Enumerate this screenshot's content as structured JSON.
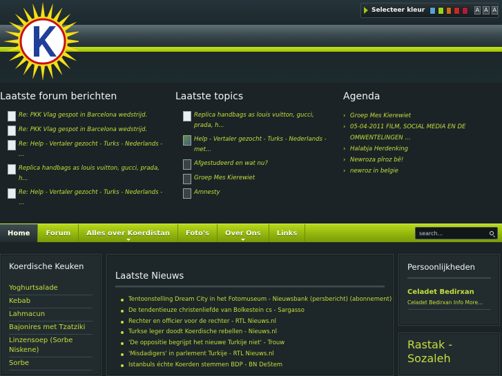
{
  "color_picker": {
    "label": "Selecteer kleur",
    "swatches": [
      "#5aa0d4",
      "#9fd11c",
      "#d2691e",
      "#c62828",
      "#b01c3c"
    ],
    "font_buttons": [
      "A",
      "A",
      "A"
    ]
  },
  "forum": {
    "title": "Laatste forum berichten",
    "items": [
      {
        "text": "Re: PKK Vlag gespot in Barcelona wedstrijd.",
        "thumb": "light"
      },
      {
        "text": "Re: PKK Vlag gespot in Barcelona wedstrijd.",
        "thumb": "light"
      },
      {
        "text": "Re: Help - Vertaler gezocht - Turks - Nederlands - ...",
        "thumb": "light"
      },
      {
        "text": "Replica handbags as louis vuitton, gucci, prada, h...",
        "thumb": "light"
      },
      {
        "text": "Re: Help - Vertaler gezocht - Turks - Nederlands - ...",
        "thumb": "light"
      }
    ]
  },
  "topics": {
    "title": "Laatste topics",
    "items": [
      {
        "text": "Replica handbags as louis vuitton, gucci, prada, h...",
        "thumb": "light"
      },
      {
        "text": "Help - Vertaler gezocht - Turks - Nederlands - met...",
        "thumb": "photo"
      },
      {
        "text": "Afgestudeerd en wat nu?",
        "thumb": "dark"
      },
      {
        "text": "Groep Mes Kierewiet",
        "thumb": "dark"
      },
      {
        "text": "Amnesty",
        "thumb": "dark"
      }
    ]
  },
  "agenda": {
    "title": "Agenda",
    "items": [
      "Groep Mes Kierewiet",
      "05-04-2011 FILM, SOCIAL MEDIA EN DE OMWENTELINGEN ...",
      "Halabja Herdenking",
      "Newroza pîroz bê!",
      "newroz in belgie"
    ]
  },
  "nav": {
    "items": [
      {
        "label": "Home",
        "active": true,
        "dropdown": false
      },
      {
        "label": "Forum",
        "active": false,
        "dropdown": false
      },
      {
        "label": "Alles over Koerdistan",
        "active": false,
        "dropdown": true
      },
      {
        "label": "Foto's",
        "active": false,
        "dropdown": false
      },
      {
        "label": "Over Ons",
        "active": false,
        "dropdown": true
      },
      {
        "label": "Links",
        "active": false,
        "dropdown": false
      }
    ],
    "search_value": "search..."
  },
  "kitchen": {
    "title": "Koerdische Keuken",
    "items": [
      "Yoghurtsalade",
      "Kebab",
      "Lahmacun",
      "Bajonires met Tzatziki",
      "Linzensoep (Sorbe Niskene)",
      "Sorbe"
    ]
  },
  "news": {
    "title": "Laatste Nieuws",
    "items": [
      "Tentoonstelling Dream City in het Fotomuseum - Nieuwsbank (persbericht) (abonnement)",
      "De tendentieuze christenliefde van Bolkestein cs - Sargasso",
      "Rechter en officier voor de rechter - RTL Nieuws.nl",
      "Turkse leger doodt Koerdische rebellen - Nieuws.nl",
      "'De oppositie begrijpt het nieuwe Turkije niet' - Trouw",
      "'Misdadigers' in parlement Turkije - RTL Nieuws.nl",
      "Istanbuls échte Koerden stemmen BDP - BN DeStem"
    ]
  },
  "persons": {
    "title": "Persoonlijkheden",
    "name": "Celadet Bedirxan",
    "info": "Celadet Bedirxan Info More..."
  },
  "rastak": {
    "text": "Rastak - Sozaleh"
  },
  "colors": {
    "accent": "#c6de3c",
    "nav_green": "#9dbf0c",
    "background": "#1b2326"
  }
}
